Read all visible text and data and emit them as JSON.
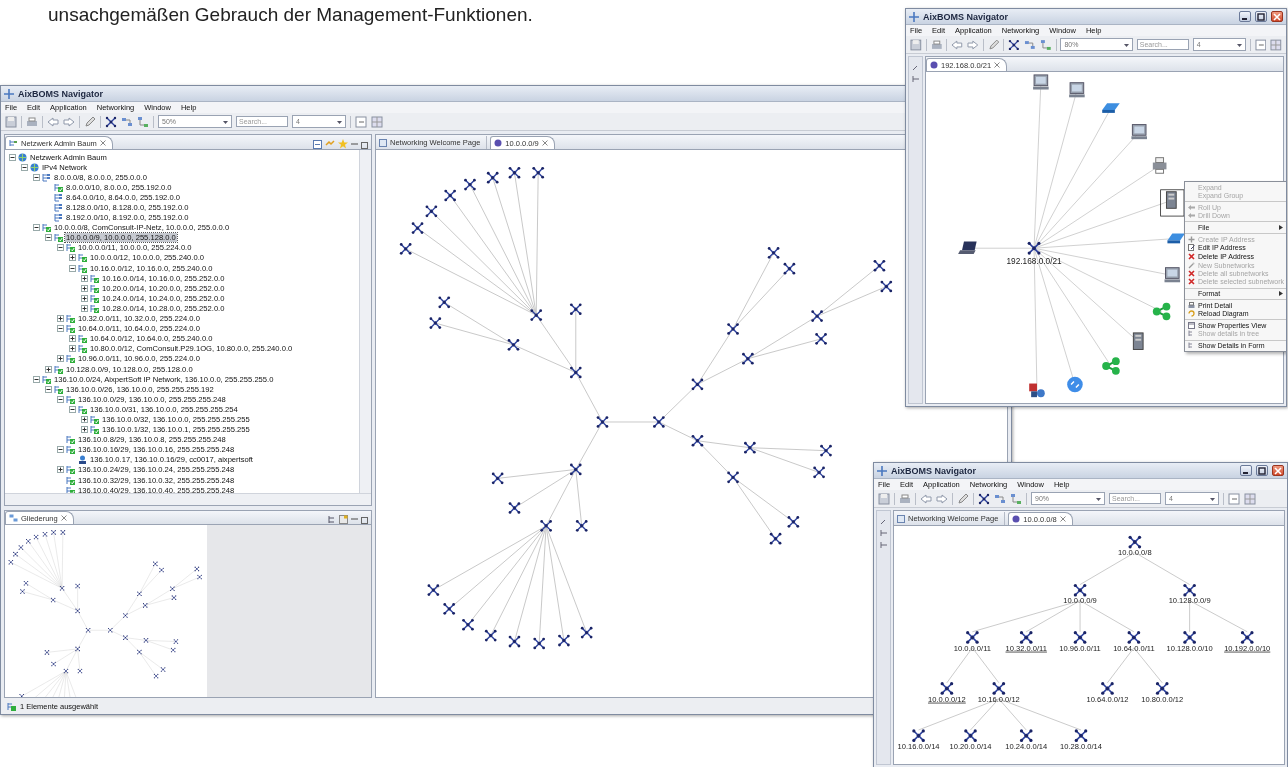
{
  "caption": "unsachgemäßen Gebrauch der Management-Funktionen.",
  "main_window": {
    "title": "AixBOMS Navigator",
    "menu": [
      "File",
      "Edit",
      "Application",
      "Networking",
      "Window",
      "Help"
    ],
    "toolbar": {
      "zoom": "50%",
      "search_placeholder": "Search...",
      "depth": "4"
    },
    "tree_view": {
      "title": "Netzwerk Admin Baum",
      "items": [
        {
          "label": "Netzwerk Admin Baum",
          "kind": "root",
          "expanded": true,
          "selected": false,
          "children": [
            {
              "label": "IPv4 Network",
              "kind": "root",
              "expanded": true,
              "selected": false,
              "children": [
                {
                  "label": "8.0.0.0/8, 8.0.0.0, 255.0.0.0",
                  "kind": "subnet",
                  "expanded": true,
                  "selected": false,
                  "children": [
                    {
                      "label": "8.0.0.0/10, 8.0.0.0, 255.192.0.0",
                      "kind": "subnet-active",
                      "selected": false
                    },
                    {
                      "label": "8.64.0.0/10, 8.64.0.0, 255.192.0.0",
                      "kind": "subnet",
                      "selected": false
                    },
                    {
                      "label": "8.128.0.0/10, 8.128.0.0, 255.192.0.0",
                      "kind": "subnet",
                      "selected": false
                    },
                    {
                      "label": "8.192.0.0/10, 8.192.0.0, 255.192.0.0",
                      "kind": "subnet",
                      "selected": false
                    }
                  ]
                },
                {
                  "label": "10.0.0.0/8, ComConsult-IP-Netz, 10.0.0.0, 255.0.0.0",
                  "kind": "subnet-active",
                  "expanded": true,
                  "selected": false,
                  "children": [
                    {
                      "label": "10.0.0.0/9, 10.0.0.0, 255.128.0.0",
                      "kind": "subnet-active",
                      "expanded": true,
                      "selected": true,
                      "children": [
                        {
                          "label": "10.0.0.0/11, 10.0.0.0, 255.224.0.0",
                          "kind": "subnet-active",
                          "expanded": true,
                          "selected": false,
                          "children": [
                            {
                              "label": "10.0.0.0/12, 10.0.0.0, 255.240.0.0",
                              "kind": "subnet-active",
                              "expanded": false,
                              "selected": false
                            },
                            {
                              "label": "10.16.0.0/12, 10.16.0.0, 255.240.0.0",
                              "kind": "subnet-active",
                              "expanded": true,
                              "selected": false,
                              "children": [
                                {
                                  "label": "10.16.0.0/14, 10.16.0.0, 255.252.0.0",
                                  "kind": "subnet-active",
                                  "expanded": false,
                                  "selected": false
                                },
                                {
                                  "label": "10.20.0.0/14, 10.20.0.0, 255.252.0.0",
                                  "kind": "subnet-active",
                                  "expanded": false,
                                  "selected": false
                                },
                                {
                                  "label": "10.24.0.0/14, 10.24.0.0, 255.252.0.0",
                                  "kind": "subnet-active",
                                  "expanded": false,
                                  "selected": false
                                },
                                {
                                  "label": "10.28.0.0/14, 10.28.0.0, 255.252.0.0",
                                  "kind": "subnet-active",
                                  "expanded": false,
                                  "selected": false
                                }
                              ]
                            }
                          ]
                        },
                        {
                          "label": "10.32.0.0/11, 10.32.0.0, 255.224.0.0",
                          "kind": "subnet-active",
                          "expanded": false,
                          "selected": false
                        },
                        {
                          "label": "10.64.0.0/11, 10.64.0.0, 255.224.0.0",
                          "kind": "subnet-active",
                          "expanded": true,
                          "selected": false,
                          "children": [
                            {
                              "label": "10.64.0.0/12, 10.64.0.0, 255.240.0.0",
                              "kind": "subnet-active",
                              "expanded": false,
                              "selected": false
                            },
                            {
                              "label": "10.80.0.0/12, ComConsult.P29.1OG, 10.80.0.0, 255.240.0.0",
                              "kind": "subnet-active",
                              "expanded": false,
                              "selected": false
                            }
                          ]
                        },
                        {
                          "label": "10.96.0.0/11, 10.96.0.0, 255.224.0.0",
                          "kind": "subnet-active",
                          "expanded": false,
                          "selected": false
                        }
                      ]
                    },
                    {
                      "label": "10.128.0.0/9, 10.128.0.0, 255.128.0.0",
                      "kind": "subnet-active",
                      "expanded": false,
                      "selected": false
                    }
                  ]
                },
                {
                  "label": "136.10.0.0/24, AixpertSoft IP Network, 136.10.0.0, 255.255.255.0",
                  "kind": "subnet-active",
                  "expanded": true,
                  "selected": false,
                  "children": [
                    {
                      "label": "136.10.0.0/26, 136.10.0.0, 255.255.255.192",
                      "kind": "subnet-active",
                      "expanded": true,
                      "selected": false,
                      "children": [
                        {
                          "label": "136.10.0.0/29, 136.10.0.0, 255.255.255.248",
                          "kind": "subnet-active",
                          "expanded": true,
                          "selected": false,
                          "children": [
                            {
                              "label": "136.10.0.0/31, 136.10.0.0, 255.255.255.254",
                              "kind": "subnet-active",
                              "expanded": true,
                              "selected": false,
                              "children": [
                                {
                                  "label": "136.10.0.0/32, 136.10.0.0, 255.255.255.255",
                                  "kind": "subnet-active",
                                  "expanded": false,
                                  "selected": false
                                },
                                {
                                  "label": "136.10.0.1/32, 136.10.0.1, 255.255.255.255",
                                  "kind": "subnet-active",
                                  "expanded": false,
                                  "selected": false
                                }
                              ]
                            }
                          ]
                        },
                        {
                          "label": "136.10.0.8/29, 136.10.0.8, 255.255.255.248",
                          "kind": "subnet-active",
                          "selected": false
                        },
                        {
                          "label": "136.10.0.16/29, 136.10.0.16, 255.255.255.248",
                          "kind": "subnet-active",
                          "expanded": true,
                          "selected": false,
                          "children": [
                            {
                              "label": "136.10.0.17, 136.10.0.16/29, cc0017, aixpertsoft",
                              "kind": "host",
                              "selected": false
                            }
                          ]
                        },
                        {
                          "label": "136.10.0.24/29, 136.10.0.24, 255.255.255.248",
                          "kind": "subnet-active",
                          "expanded": false,
                          "selected": false
                        },
                        {
                          "label": "136.10.0.32/29, 136.10.0.32, 255.255.255.248",
                          "kind": "subnet-active",
                          "selected": false
                        },
                        {
                          "label": "136.10.0.40/29, 136.10.0.40, 255.255.255.248",
                          "kind": "subnet-active",
                          "selected": false
                        }
                      ]
                    }
                  ]
                }
              ]
            }
          ]
        }
      ]
    },
    "outline_view": {
      "title": "Gliederung"
    },
    "editor_tabs": [
      {
        "label": "Networking Welcome Page",
        "selected": false
      },
      {
        "label": "10.0.0.0/9",
        "selected": true
      }
    ],
    "status_bar": "1 Elemente ausgewählt"
  },
  "detail_window": {
    "title": "AixBOMS Navigator",
    "menu": [
      "File",
      "Edit",
      "Application",
      "Networking",
      "Window",
      "Help"
    ],
    "toolbar": {
      "zoom": "80%",
      "search_placeholder": "Search...",
      "depth": "4"
    },
    "editor_tabs": [
      {
        "label": "192.168.0.0/21",
        "selected": true
      }
    ],
    "center_label": "192.168.0.0/21",
    "context_menu": [
      {
        "label": "Expand",
        "kind": "none",
        "disabled": true,
        "submenu": false,
        "separator_after": false
      },
      {
        "label": "Expand Group",
        "kind": "none",
        "disabled": true,
        "submenu": false,
        "separator_after": true
      },
      {
        "label": "Roll Up",
        "kind": "arrow",
        "disabled": true,
        "submenu": false,
        "separator_after": false
      },
      {
        "label": "Drill Down",
        "kind": "arrow",
        "disabled": true,
        "submenu": false,
        "separator_after": true
      },
      {
        "label": "File",
        "kind": "none",
        "disabled": false,
        "submenu": true,
        "separator_after": true
      },
      {
        "label": "Create IP Address",
        "kind": "plus",
        "disabled": true,
        "submenu": false,
        "separator_after": false
      },
      {
        "label": "Edit IP Address",
        "kind": "edit",
        "disabled": false,
        "submenu": false,
        "separator_after": false
      },
      {
        "label": "Delete IP Address",
        "kind": "delete",
        "disabled": false,
        "submenu": false,
        "separator_after": false
      },
      {
        "label": "New Subnetworks",
        "kind": "wand",
        "disabled": true,
        "submenu": false,
        "separator_after": false
      },
      {
        "label": "Delete all subnetworks",
        "kind": "delete",
        "disabled": true,
        "submenu": false,
        "separator_after": false
      },
      {
        "label": "Delete selected subnetwork",
        "kind": "delete",
        "disabled": true,
        "submenu": false,
        "separator_after": true
      },
      {
        "label": "Format",
        "kind": "none",
        "disabled": false,
        "submenu": true,
        "separator_after": true
      },
      {
        "label": "Print Detail",
        "kind": "print",
        "disabled": false,
        "submenu": false,
        "separator_after": false
      },
      {
        "label": "Reload Diagram",
        "kind": "reload",
        "disabled": false,
        "submenu": false,
        "separator_after": true
      },
      {
        "label": "Show Properties View",
        "kind": "window",
        "disabled": false,
        "submenu": false,
        "separator_after": false
      },
      {
        "label": "Show details in tree",
        "kind": "tree",
        "disabled": true,
        "submenu": false,
        "separator_after": true
      },
      {
        "label": "Show Details in Form",
        "kind": "tree",
        "disabled": false,
        "submenu": false,
        "separator_after": false
      }
    ]
  },
  "tree_window": {
    "title": "AixBOMS Navigator",
    "menu": [
      "File",
      "Edit",
      "Application",
      "Networking",
      "Window",
      "Help"
    ],
    "toolbar": {
      "zoom": "90%",
      "search_placeholder": "Search...",
      "depth": "4"
    },
    "editor_tabs": [
      {
        "label": "Networking Welcome Page",
        "selected": false
      },
      {
        "label": "10.0.0.0/8",
        "selected": true
      }
    ],
    "nodes": [
      {
        "label": "10.0.0.0/8",
        "linked": false,
        "children": [
          {
            "label": "10.0.0.0/9",
            "linked": false,
            "children": [
              {
                "label": "10.0.0.0/11",
                "linked": false,
                "children": [
                  {
                    "label": "10.0.0.0/12",
                    "linked": true
                  },
                  {
                    "label": "10.16.0.0/12",
                    "linked": false,
                    "children": [
                      {
                        "label": "10.16.0.0/14",
                        "linked": false
                      },
                      {
                        "label": "10.20.0.0/14",
                        "linked": false
                      },
                      {
                        "label": "10.24.0.0/14",
                        "linked": false
                      },
                      {
                        "label": "10.28.0.0/14",
                        "linked": false
                      }
                    ]
                  }
                ]
              },
              {
                "label": "10.32.0.0/11",
                "linked": true
              },
              {
                "label": "10.96.0.0/11",
                "linked": false
              },
              {
                "label": "10.64.0.0/11",
                "linked": false,
                "children": [
                  {
                    "label": "10.64.0.0/12",
                    "linked": false
                  },
                  {
                    "label": "10.80.0.0/12",
                    "linked": false
                  }
                ]
              }
            ]
          },
          {
            "label": "10.128.0.0/9",
            "linked": false,
            "children": [
              {
                "label": "10.128.0.0/10",
                "linked": false
              },
              {
                "label": "10.192.0.0/10",
                "linked": true
              }
            ]
          }
        ]
      }
    ]
  }
}
